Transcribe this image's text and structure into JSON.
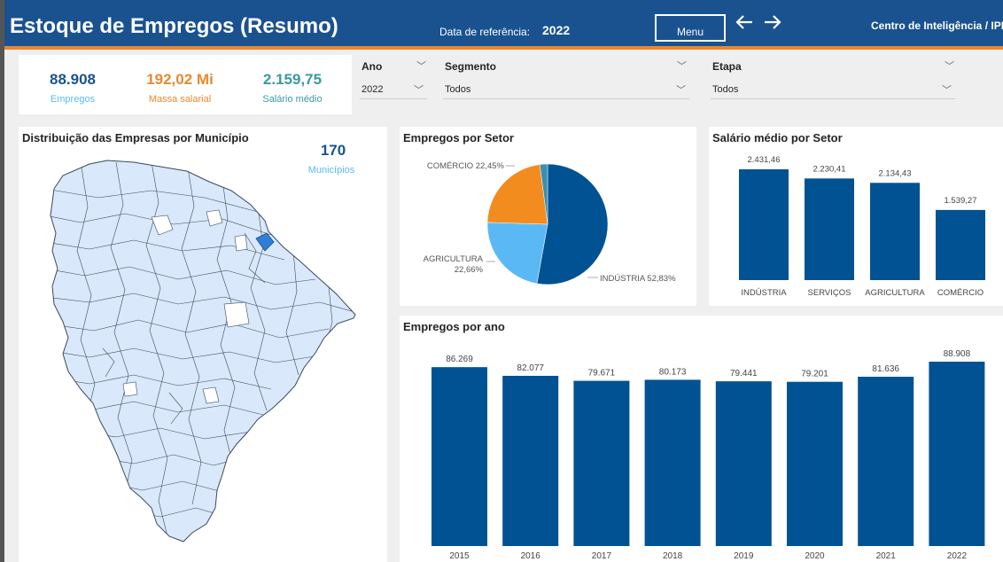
{
  "header": {
    "title": "Estoque de Empregos (Resumo)",
    "ref_label": "Data de referência:",
    "ref_value": "2022",
    "menu_label": "Menu",
    "back_glyph": "🡐",
    "forward_glyph": "🡒",
    "center": "Centro de Inteligência / IPDC"
  },
  "kpis": [
    {
      "value": "88.908",
      "label": "Empregos",
      "color": "#1a5290"
    },
    {
      "value": "192,02 Mi",
      "label": "Massa salarial",
      "color": "#e9892f"
    },
    {
      "value": "2.159,75",
      "label": "Salário médio",
      "color": "#3a9aa0"
    }
  ],
  "filters": {
    "ano": {
      "label": "Ano",
      "value": "2022"
    },
    "segmento": {
      "label": "Segmento",
      "value": "Todos"
    },
    "etapa": {
      "label": "Etapa",
      "value": "Todos"
    }
  },
  "map": {
    "title": "Distribuição das Empresas por Município",
    "count": "170",
    "count_label": "Municípios",
    "fill": "#d9e8fb",
    "highlight": "#2f7ed8"
  },
  "colors": {
    "bar": "#005293",
    "pie_industria": "#005293",
    "pie_agricultura": "#5ab9f5",
    "pie_comercio": "#f28c1f",
    "pie_servicos": "#3a8fb0",
    "accent": "#e9892f",
    "header": "#1a5290"
  },
  "chart_data": [
    {
      "type": "pie",
      "title": "Empregos por Setor",
      "series": [
        {
          "name": "INDÚSTRIA",
          "value": 52.83,
          "label": "INDÚSTRIA 52,83%"
        },
        {
          "name": "AGRICULTURA",
          "value": 22.66,
          "label": "AGRICULTURA 22,66%"
        },
        {
          "name": "COMÉRCIO",
          "value": 22.45,
          "label": "COMÉRCIO 22,45%"
        },
        {
          "name": "SERVIÇOS",
          "value": 2.06,
          "label": ""
        }
      ]
    },
    {
      "type": "bar",
      "title": "Salário médio por Setor",
      "categories": [
        "INDÚSTRIA",
        "SERVIÇOS",
        "AGRICULTURA",
        "COMÉRCIO"
      ],
      "values": [
        2431.46,
        2230.41,
        2134.43,
        1539.27
      ],
      "labels": [
        "2.431,46",
        "2.230,41",
        "2.134,43",
        "1.539,27"
      ],
      "ylim": [
        0,
        2431.46
      ]
    },
    {
      "type": "bar",
      "title": "Empregos por ano",
      "categories": [
        "2015",
        "2016",
        "2017",
        "2018",
        "2019",
        "2020",
        "2021",
        "2022"
      ],
      "values": [
        86269,
        82077,
        79671,
        80173,
        79441,
        79201,
        81636,
        88908
      ],
      "labels": [
        "86.269",
        "82.077",
        "79.671",
        "80.173",
        "79.441",
        "79.201",
        "81.636",
        "88.908"
      ],
      "ylim": [
        0,
        88908
      ]
    }
  ]
}
